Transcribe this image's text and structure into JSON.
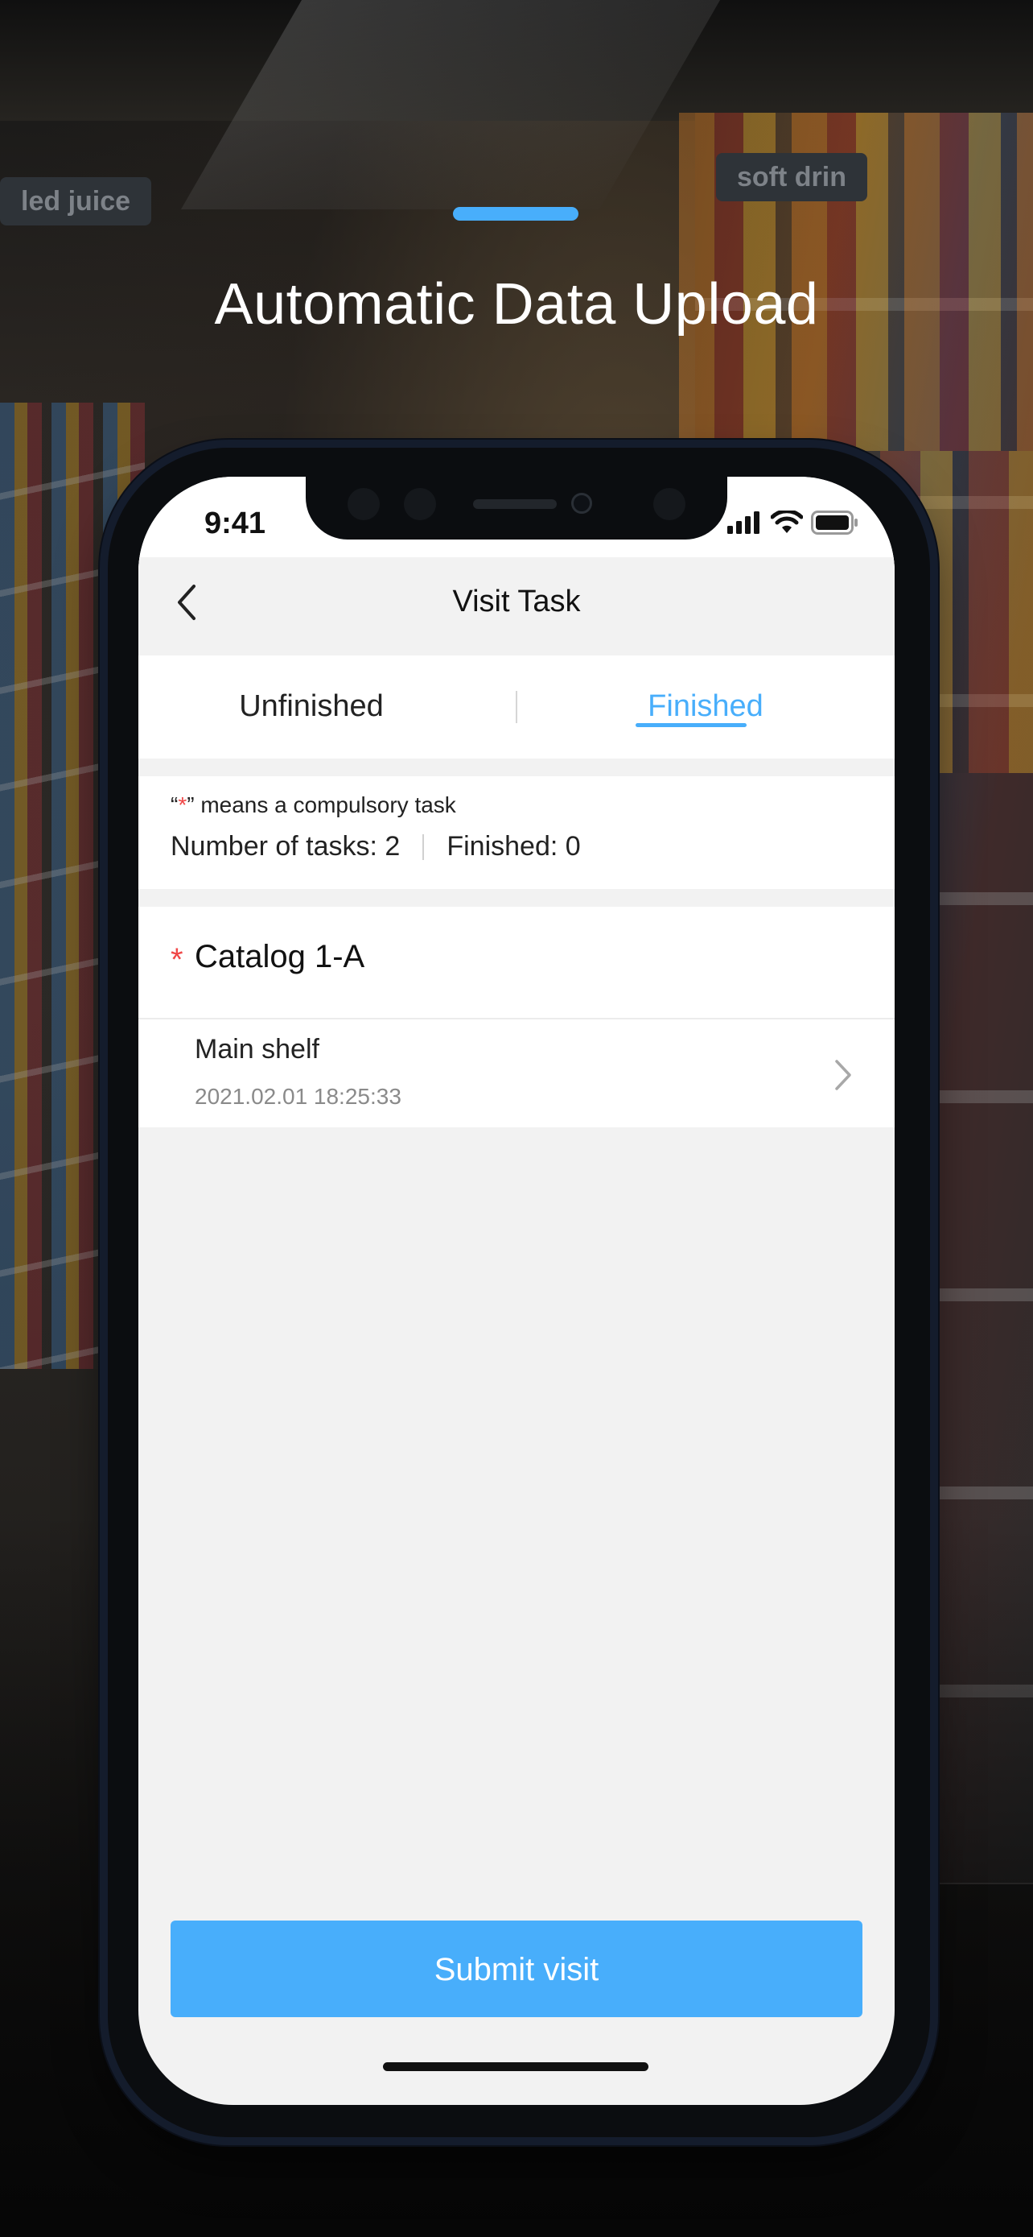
{
  "headline": "Automatic Data Upload",
  "background": {
    "signs": [
      "led juice",
      "soft drin"
    ]
  },
  "status_bar": {
    "time": "9:41",
    "icons": [
      "signal-icon",
      "wifi-icon",
      "battery-icon"
    ]
  },
  "nav": {
    "title": "Visit Task",
    "back_icon": "chevron-left-icon"
  },
  "tabs": [
    {
      "label": "Unfinished",
      "active": false
    },
    {
      "label": "Finished",
      "active": true
    }
  ],
  "info": {
    "legend_open": "“",
    "legend_star": "*",
    "legend_close": "” means a compulsory task",
    "tasks_count": "Number of tasks: 2",
    "finished_count": "Finished: 0"
  },
  "catalog": {
    "required_mark": "*",
    "name": "Catalog 1-A"
  },
  "task": {
    "name": "Main shelf",
    "date": "2021.02.01  18:25:33"
  },
  "submit_label": "Submit visit",
  "colors": {
    "accent": "#48aefb",
    "required": "#f04747",
    "screen_bg": "#f2f2f2"
  }
}
